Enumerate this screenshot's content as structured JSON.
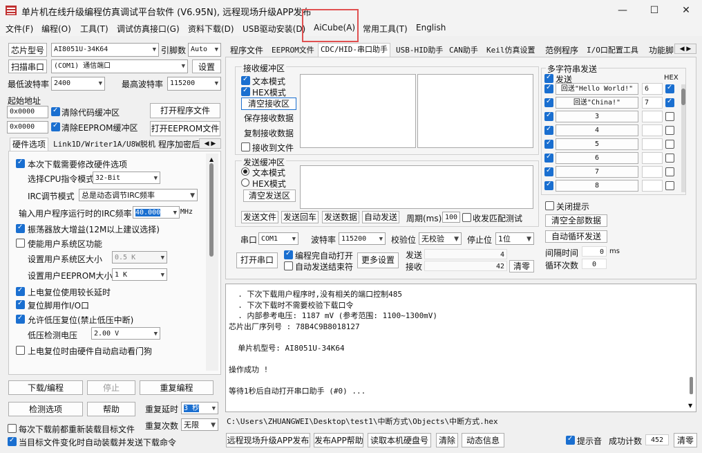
{
  "window": {
    "title": "单片机在线升级编程仿真调试平台软件 (V6.95N), 远程现场升级APP发布",
    "minimize": "—",
    "maximize": "☐",
    "close": "✕"
  },
  "menu": [
    "文件(F)",
    "编程(O)",
    "工具(T)",
    "调试仿真接口(G)",
    "资料下载(D)",
    "USB驱动安装(D)",
    "AiCube(A)",
    "常用工具(T)",
    "English"
  ],
  "left": {
    "chip_model_btn": "芯片型号",
    "chip_model": "AI8051U-34K64",
    "pins_label": "引脚数",
    "pins_value": "Auto",
    "scan_port_btn": "扫描串口",
    "port_value": "(COM1) 通信端口",
    "settings_btn": "设置",
    "min_baud_label": "最低波特率",
    "min_baud": "2400",
    "max_baud_label": "最高波特率",
    "max_baud": "115200",
    "start_addr_label": "起始地址",
    "addr1": "0x0000",
    "clear_code_label": "清除代码缓冲区",
    "open_prog_btn": "打开程序文件",
    "addr2": "0x0000",
    "clear_eeprom_label": "清除EEPROM缓冲区",
    "open_eeprom_btn": "打开EEPROM文件",
    "tabs": [
      "硬件选项",
      "Link1D/Writer1A/U8W脱机",
      "程序加密后"
    ],
    "hw": {
      "need_modify": "本次下载需要修改硬件选项",
      "cpu_label": "选择CPU指令模式",
      "cpu_value": "32-Bit",
      "irc_label": "IRC调节模式",
      "irc_value": "总是动态调节IRC频率",
      "freq_label": "输入用户程序运行时的IRC频率",
      "freq_value": "40.000",
      "freq_unit": "MHz",
      "osc_gain": "振荡器放大增益(12M以上建议选择)",
      "use_sys": "使能用户系统区功能",
      "sys_size_label": "设置用户系统区大小",
      "sys_size": "0.5 K",
      "eeprom_size_label": "设置用户EEPROM大小",
      "eeprom_size": "1   K",
      "long_delay": "上电复位使用较长延时",
      "reset_io": "复位脚用作I/O口",
      "lvd_reset": "允许低压复位(禁止低压中断)",
      "lvd_label": "低压检测电压",
      "lvd_value": "2.00 V",
      "wdt": "上电复位时由硬件自动启动看门狗"
    },
    "download_btn": "下载/编程",
    "stop_btn": "停止",
    "reprogram_btn": "重复编程",
    "check_btn": "检测选项",
    "help_btn": "帮助",
    "repeat_delay_label": "重复延时",
    "repeat_delay": "3 秒",
    "repeat_count_label": "重复次数",
    "repeat_count": "无限",
    "reload_each": "每次下载前都重新装载目标文件",
    "auto_load": "当目标文件变化时自动装载并发送下载命令"
  },
  "right_tabs": [
    "程序文件",
    "EEPROM文件",
    "CDC/HID-串口助手",
    "USB-HID助手",
    "CAN助手",
    "Keil仿真设置",
    "范例程序",
    "I/O口配置工具",
    "功能脚"
  ],
  "serial": {
    "recv_group": "接收缓冲区",
    "text_mode": "文本模式",
    "hex_mode": "HEX模式",
    "clear_recv": "清空接收区",
    "save_recv": "保存接收数据",
    "copy_recv": "复制接收数据",
    "recv_to_file": "接收到文件",
    "send_group": "发送缓冲区",
    "send_text_mode": "文本模式",
    "send_hex_mode": "HEX模式",
    "clear_send": "清空发送区",
    "send_file": "发送文件",
    "send_return": "发送回车",
    "send_data": "发送数据",
    "auto_send": "自动发送",
    "period_label": "周期(ms)",
    "period": "100",
    "no_match": "收发匹配测试",
    "port_label": "串口",
    "port": "COM1",
    "baud_label": "波特率",
    "baud": "115200",
    "parity_label": "校验位",
    "parity": "无校验",
    "stop_label": "停止位",
    "stop": "1位",
    "open_port": "打开串口",
    "auto_open": "编程完自动打开",
    "auto_send_end": "自动发送结束符",
    "more_settings": "更多设置",
    "sent_label": "发送",
    "sent": "4",
    "recv_label": "接收",
    "recv": "42",
    "clear_count": "清零"
  },
  "multi": {
    "title": "多字符串发送",
    "send_label": "发送",
    "hex_label": "HEX",
    "items": [
      {
        "text": "回送\"Hello World!\"",
        "delay": "6",
        "hex": true
      },
      {
        "text": "回送\"China!\"",
        "delay": "7",
        "hex": true
      },
      {
        "text": "3",
        "delay": "",
        "hex": false
      },
      {
        "text": "4",
        "delay": "",
        "hex": false
      },
      {
        "text": "5",
        "delay": "",
        "hex": false
      },
      {
        "text": "6",
        "delay": "",
        "hex": false
      },
      {
        "text": "7",
        "delay": "",
        "hex": false
      },
      {
        "text": "8",
        "delay": "",
        "hex": false
      }
    ],
    "close_hint": "关闭提示",
    "clear_all": "清空全部数据",
    "auto_loop": "自动循环发送",
    "interval_label": "间隔时间",
    "interval": "0",
    "interval_unit": "ms",
    "loop_label": "循环次数",
    "loop": "0"
  },
  "log": [
    "  . 下次下载用户程序时,没有相关的端口控制485",
    "  . 下次下载时不需要校验下载口令",
    "  . 内部参考电压: 1187 mV (参考范围: 1100~1300mV)",
    "芯片出厂序列号 : 78B4C9B8018127",
    "",
    "  单片机型号: AI8051U-34K64",
    "",
    "操作成功 !",
    "",
    "等待1秒后自动打开串口助手 (#0) ..."
  ],
  "path": "C:\\Users\\ZHUANGWEI\\Desktop\\test1\\中断方式\\Objects\\中断方式.hex",
  "bottom": {
    "remote_btn": "远程现场升级APP发布",
    "publish_help_btn": "发布APP帮助",
    "read_disk_btn": "读取本机硬盘号",
    "clear_btn": "清除",
    "dynamic_btn": "动态信息",
    "beep_label": "提示音",
    "success_label": "成功计数",
    "success_count": "452",
    "reset_btn": "清零"
  }
}
